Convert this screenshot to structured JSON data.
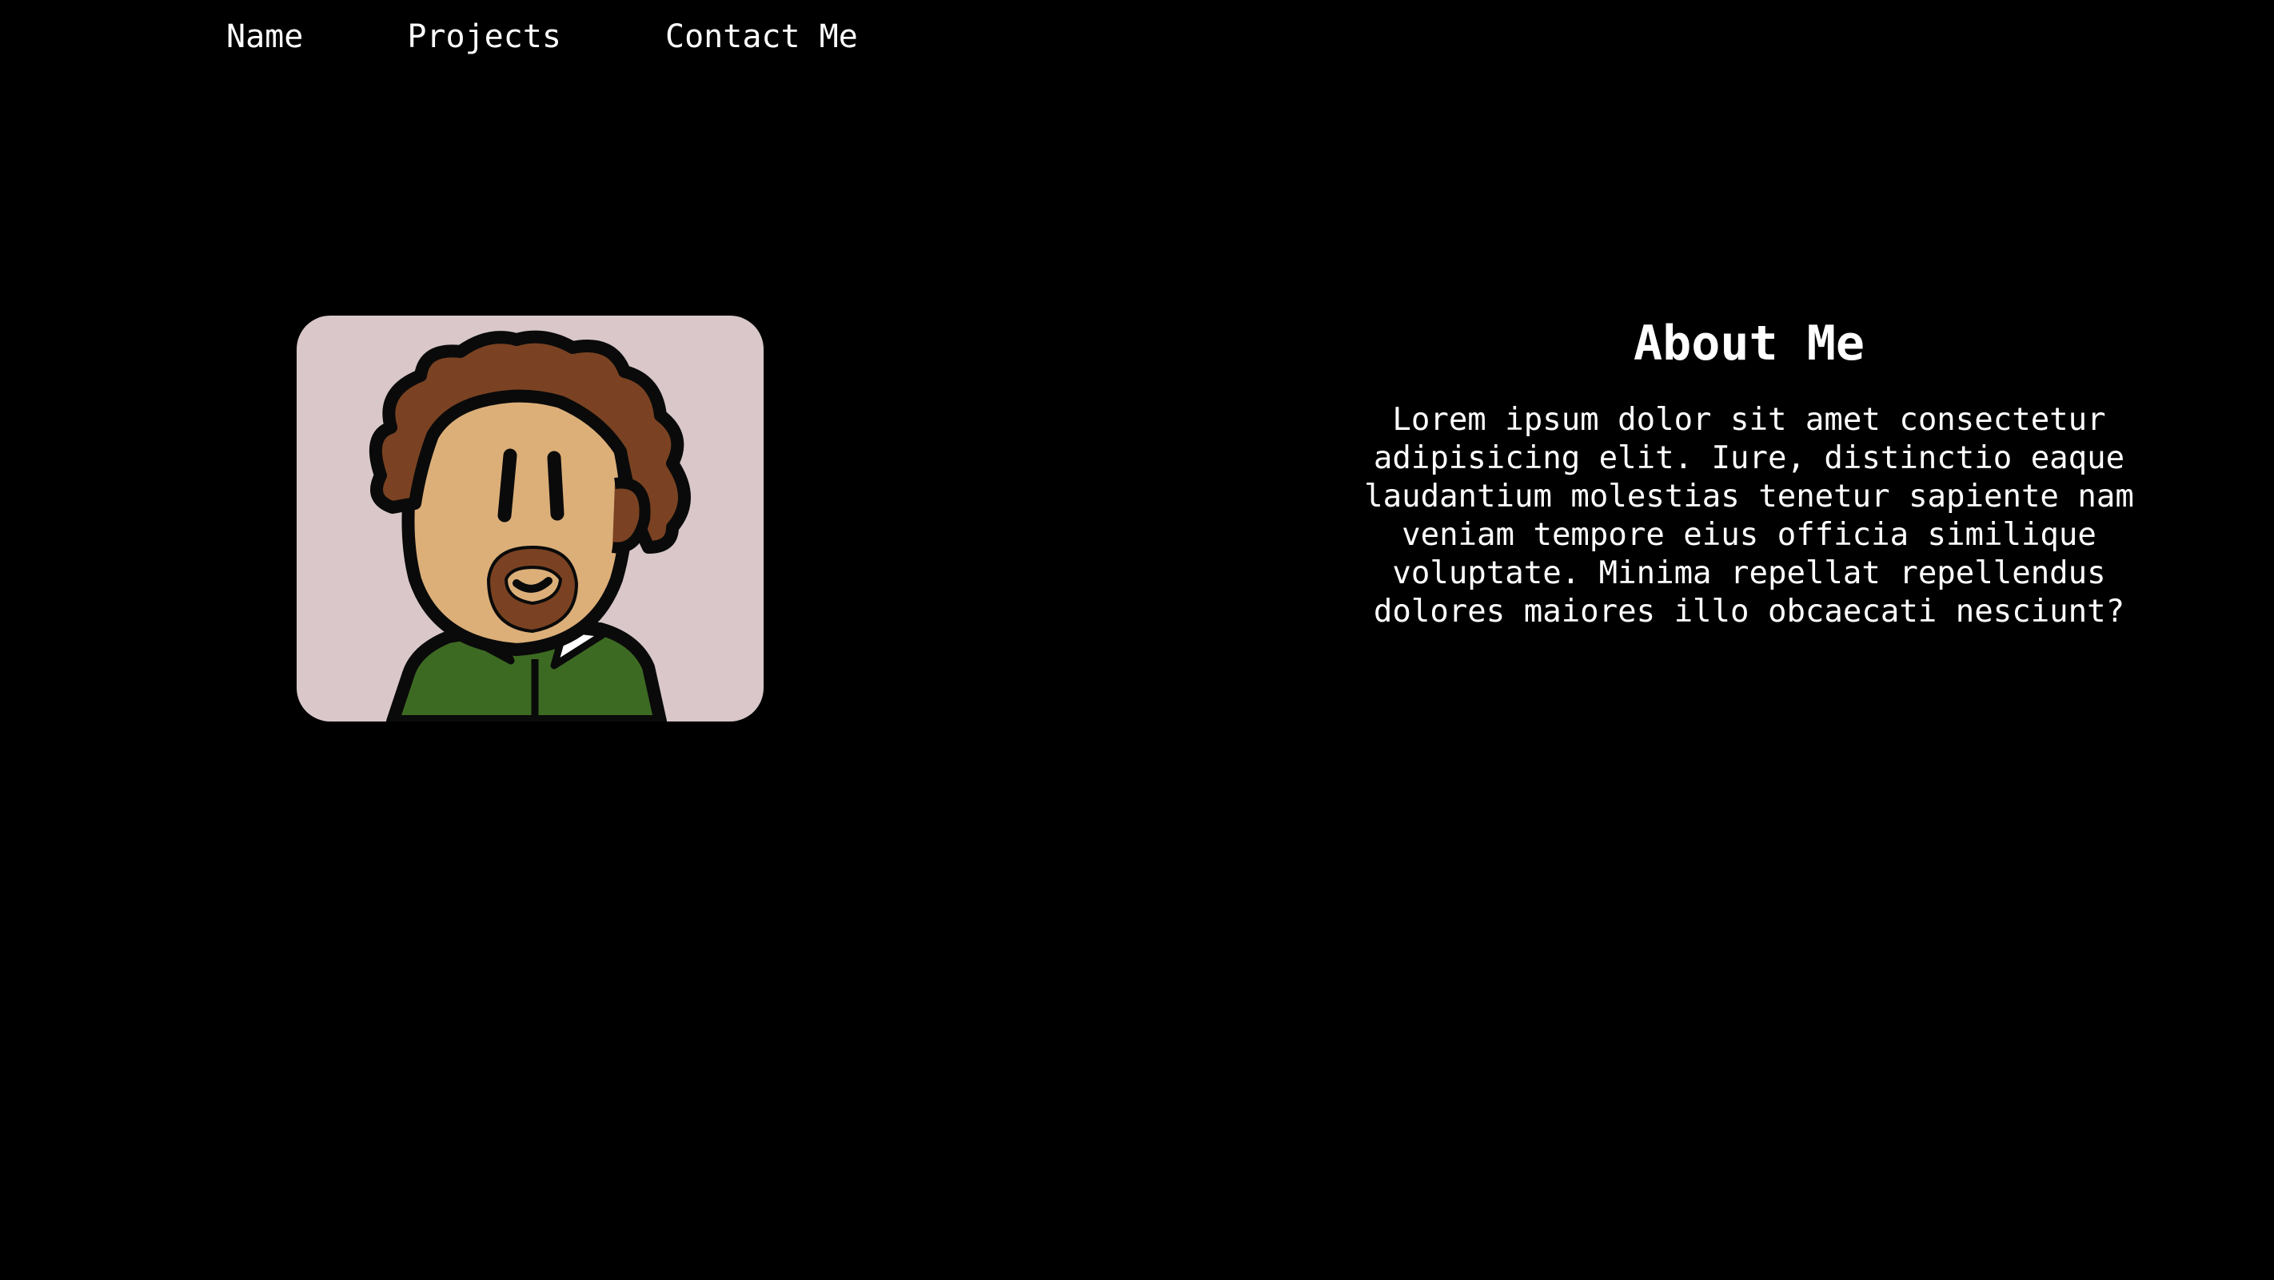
{
  "nav": {
    "items": [
      {
        "label": "Name"
      },
      {
        "label": "Projects"
      },
      {
        "label": "Contact Me"
      }
    ]
  },
  "avatar": {
    "icon": "cartoon-portrait-icon",
    "background_color": "#d9c7c9",
    "skin_color": "#dcaf79",
    "hair_color": "#7a4222",
    "shirt_color": "#3d6a23"
  },
  "about": {
    "title": "About Me",
    "body": "Lorem ipsum dolor sit amet consectetur adipisicing elit. Iure, distinctio eaque laudantium molestias tenetur sapiente nam veniam tempore eius officia similique voluptate. Minima repellat repellendus dolores maiores illo obcaecati nesciunt?"
  },
  "colors": {
    "page_background": "#000000",
    "text": "#ffffff"
  }
}
